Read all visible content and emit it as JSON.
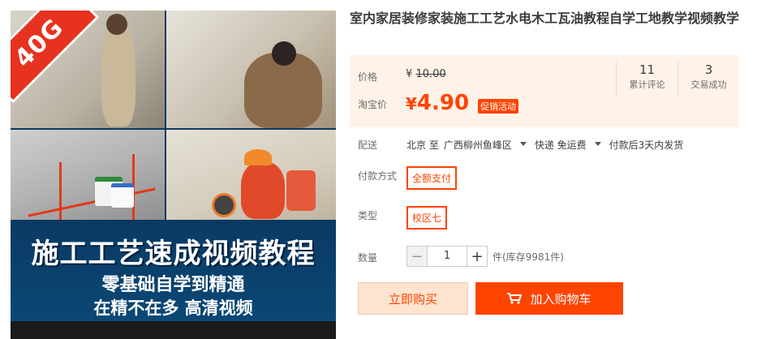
{
  "product": {
    "title": "室内家居装修家装施工工艺水电木工瓦油教程自学工地教学视频教学",
    "image": {
      "badge": "40G",
      "banner_title": "施工工艺速成视频教程",
      "banner_line1": "零基础自学到精通",
      "banner_line2": "在精不在多 高清视频"
    }
  },
  "price": {
    "price_label": "价格",
    "old_currency": "¥",
    "old_value": "10.00",
    "taobao_label": "淘宝价",
    "now_currency": "¥",
    "now_value": "4.90",
    "promo_label": "促销活动"
  },
  "stats": {
    "reviews_count": "11",
    "reviews_label": "累计评论",
    "sales_count": "3",
    "sales_label": "交易成功"
  },
  "delivery": {
    "label": "配送",
    "from": "北京 至",
    "to": "广西柳州鱼峰区",
    "shipping": "快递 免运费",
    "dispatch": "付款后3天内发货"
  },
  "options": {
    "payment_label": "付款方式",
    "payment_value": "全额支付",
    "type_label": "类型",
    "type_value": "校区七"
  },
  "quantity": {
    "label": "数量",
    "minus": "−",
    "value": "1",
    "plus": "+",
    "stock": "件(库存9981件)"
  },
  "actions": {
    "buy_now": "立即购买",
    "add_to_cart": "加入购物车"
  },
  "colors": {
    "accent": "#ff4400",
    "price_bg": "#fff2e8",
    "buy_bg": "#ffe4d0"
  }
}
